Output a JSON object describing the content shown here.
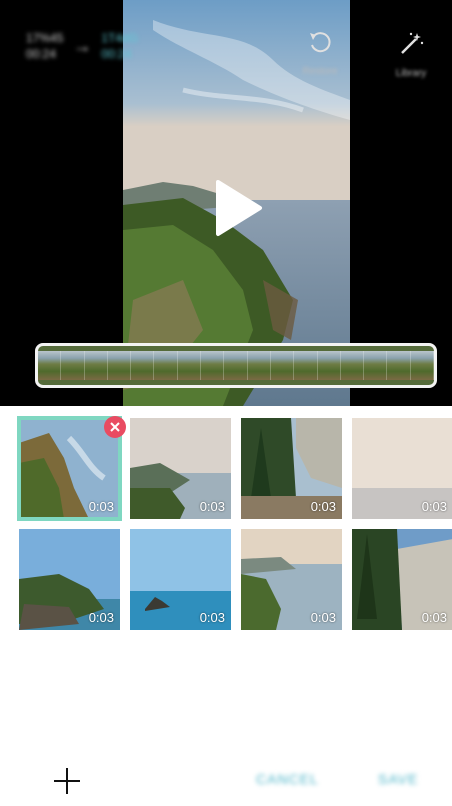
{
  "header": {
    "original_duration": {
      "time": "17%45",
      "sub": "00:24"
    },
    "new_duration": {
      "time": "1T4dG",
      "sub": "00:24"
    },
    "restore_label": "Restore",
    "library_label": "Library"
  },
  "clips": [
    {
      "duration": "0:03"
    },
    {
      "duration": "0:03"
    },
    {
      "duration": "0:03"
    },
    {
      "duration": "0:03"
    },
    {
      "duration": "0:03"
    },
    {
      "duration": "0:03"
    },
    {
      "duration": "0:03"
    },
    {
      "duration": "0:03"
    }
  ],
  "footer": {
    "cancel_label": "CANCEL",
    "save_label": "SAVE"
  },
  "icons": {
    "add": "plus-icon",
    "restore": "restore-icon",
    "library": "magic-wand-icon",
    "play": "play-icon",
    "remove": "remove-icon"
  },
  "colors": {
    "accent": "#4bb4c8",
    "selection": "#7fd7c1",
    "remove": "#e94b62"
  }
}
